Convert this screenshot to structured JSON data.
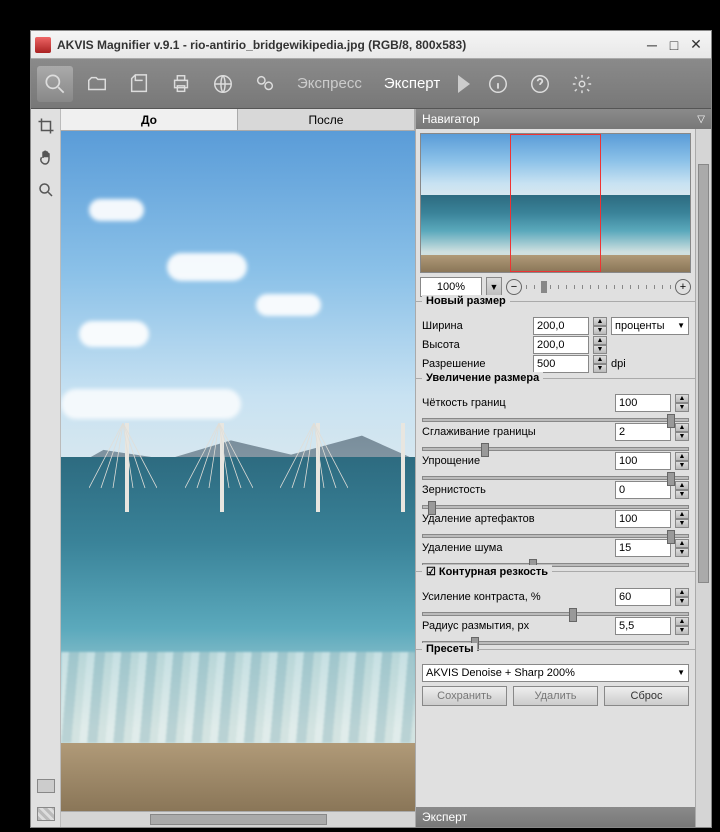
{
  "title": "AKVIS Magnifier v.9.1 - rio-antirio_bridgewikipedia.jpg (RGB/8, 800x583)",
  "toolbar": {
    "mode1": "Экспресс",
    "mode2": "Эксперт"
  },
  "tabs": {
    "before": "До",
    "after": "После"
  },
  "navigator": {
    "title": "Навигатор",
    "zoom": "100%"
  },
  "newsize": {
    "title": "Новый размер",
    "width_lbl": "Ширина",
    "width_val": "200,0",
    "height_lbl": "Высота",
    "height_val": "200,0",
    "res_lbl": "Разрешение",
    "res_val": "500",
    "res_unit": "dpi",
    "units": "проценты"
  },
  "enlarge": {
    "title": "Увеличение размера",
    "edge_lbl": "Чёткость границ",
    "edge_val": "100",
    "smooth_lbl": "Сглаживание границы",
    "smooth_val": "2",
    "simplify_lbl": "Упрощение",
    "simplify_val": "100",
    "grain_lbl": "Зернистость",
    "grain_val": "0",
    "artifact_lbl": "Удаление артефактов",
    "artifact_val": "100",
    "noise_lbl": "Удаление шума",
    "noise_val": "15"
  },
  "unsharp": {
    "title": "Контурная резкость",
    "contrast_lbl": "Усиление контраста, %",
    "contrast_val": "60",
    "radius_lbl": "Радиус размытия, px",
    "radius_val": "5,5"
  },
  "presets": {
    "title": "Пресеты",
    "current": "AKVIS Denoise + Sharp 200%",
    "save": "Сохранить",
    "delete": "Удалить",
    "reset": "Сброс"
  },
  "footer": "Эксперт"
}
